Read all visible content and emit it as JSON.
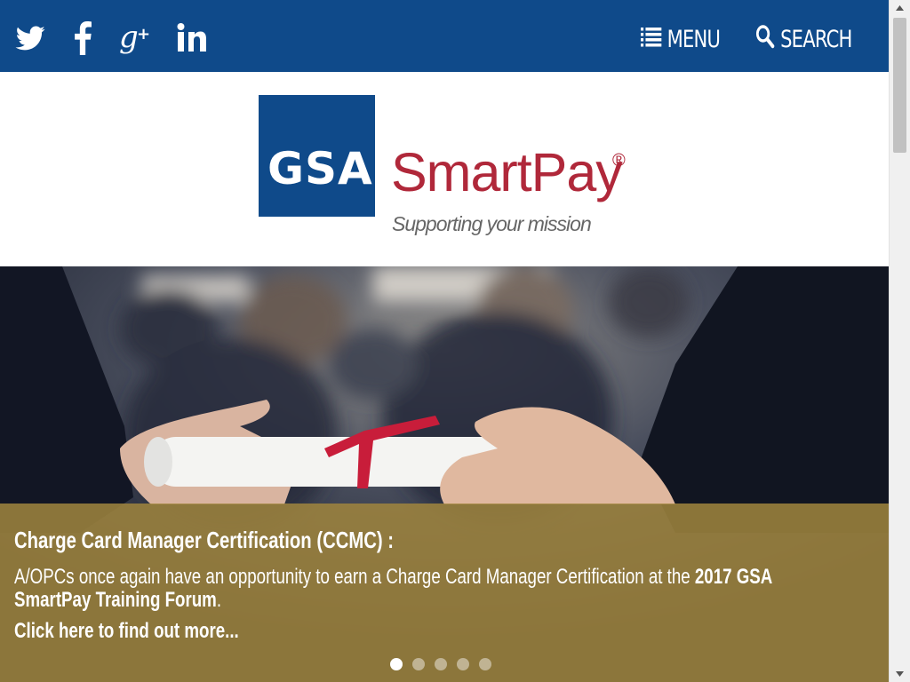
{
  "header": {
    "social": [
      {
        "name": "twitter-icon"
      },
      {
        "name": "facebook-icon"
      },
      {
        "name": "google-plus-icon"
      },
      {
        "name": "linkedin-icon"
      }
    ],
    "menu_label": "MENU",
    "search_label": "SEARCH",
    "bar_color": "#0f4a8a"
  },
  "logo": {
    "box_text": "GSA",
    "brand": "SmartPay",
    "registered": "®",
    "tagline": "Supporting your mission",
    "brand_color": "#b0283a"
  },
  "slide": {
    "title": "Charge Card Manager Certification (CCMC) :",
    "body_start": "A/OPCs once again have an opportunity to earn a Charge Card Manager Certification at the ",
    "body_bold": "2017 GSA SmartPay Training Forum",
    "body_end": ".",
    "link": "Click here to find out more...",
    "caption_color": "#a0853e",
    "dots_total": 5,
    "active_dot": 1
  }
}
